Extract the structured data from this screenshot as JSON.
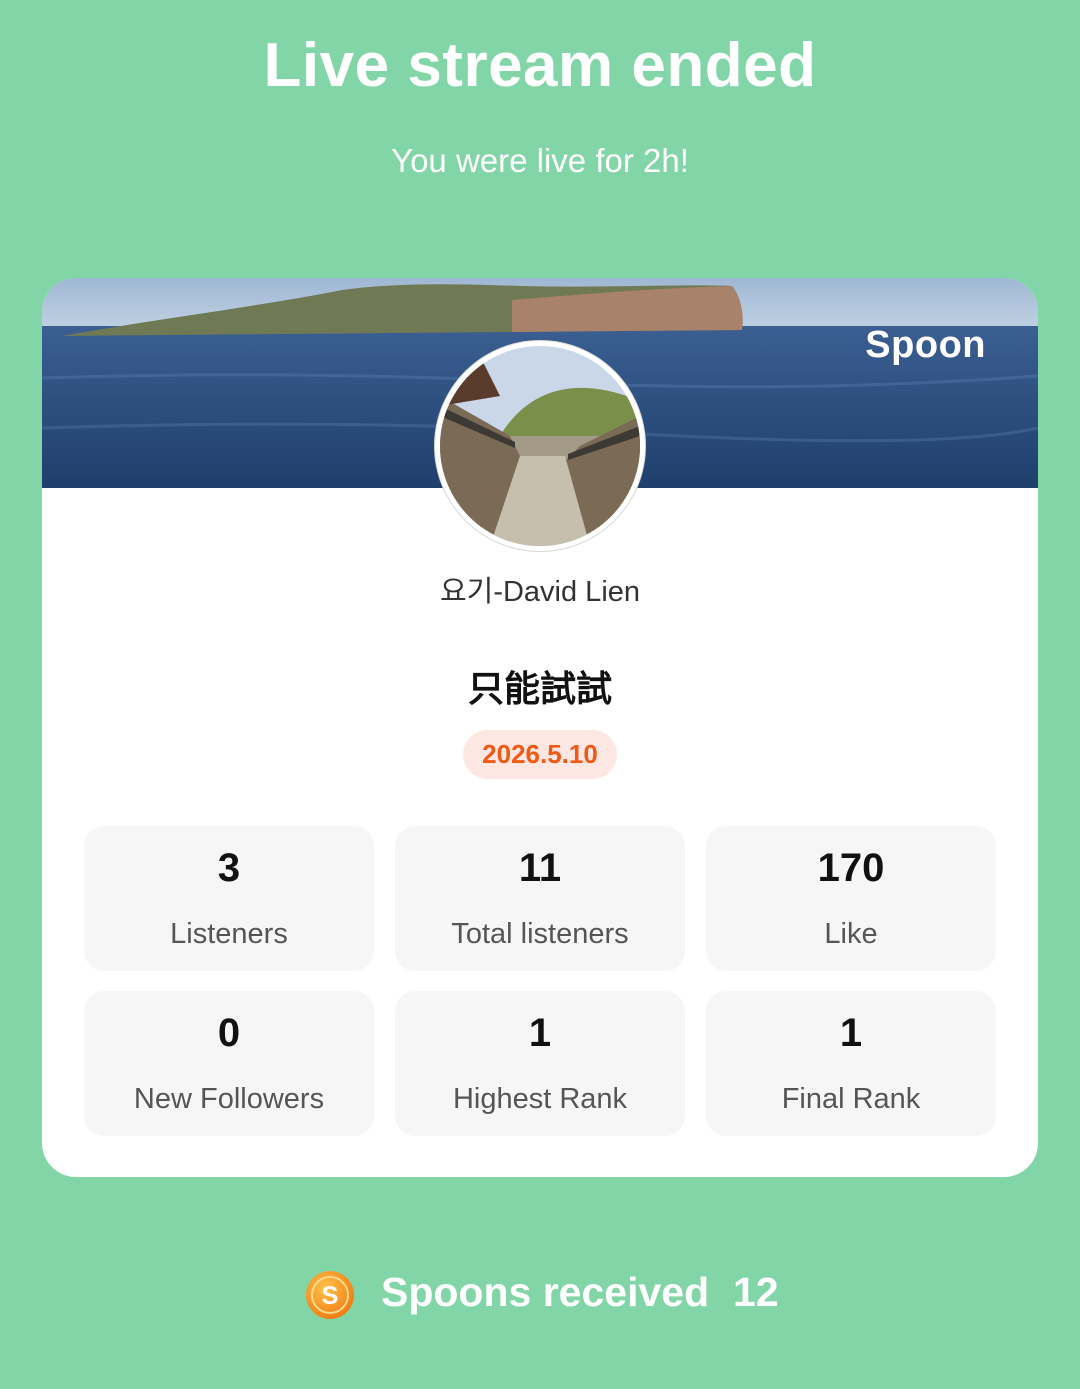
{
  "header": {
    "title": "Live stream ended",
    "subtitle": "You were live for 2h!"
  },
  "card": {
    "brand": "Spoon",
    "username": "요기-David Lien",
    "stream_title": "只能試試",
    "date": "2026.5.10"
  },
  "stats": [
    {
      "value": "3",
      "label": "Listeners"
    },
    {
      "value": "11",
      "label": "Total listeners"
    },
    {
      "value": "170",
      "label": "Like"
    },
    {
      "value": "0",
      "label": "New Followers"
    },
    {
      "value": "1",
      "label": "Highest Rank"
    },
    {
      "value": "1",
      "label": "Final Rank"
    }
  ],
  "footer": {
    "spoons_label": "Spoons received",
    "spoons_count": "12",
    "coin_icon": "spoon-coin-icon"
  },
  "colors": {
    "background": "#82d5a7",
    "date_text": "#f05a14",
    "date_bg": "#fde7e3",
    "coin": "#f7931e"
  }
}
